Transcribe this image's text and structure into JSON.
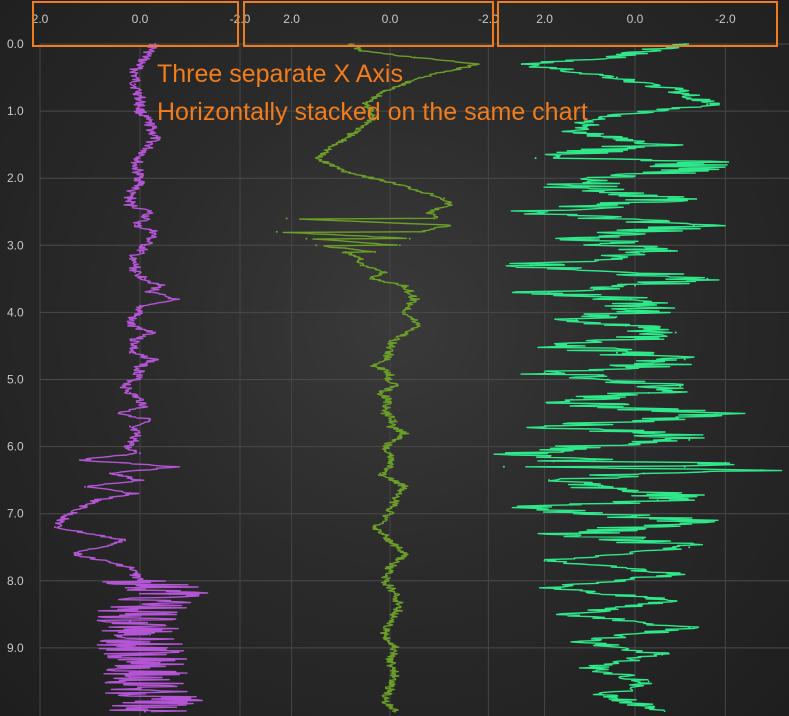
{
  "chart_data": {
    "type": "line",
    "title": "",
    "annotation_lines": [
      "Three separate X Axis",
      "Horizontally stacked on the same chart"
    ],
    "y_axis": {
      "ticks": [
        0.0,
        1.0,
        2.0,
        3.0,
        4.0,
        5.0,
        6.0,
        7.0,
        8.0,
        9.0
      ],
      "tick_labels": [
        "0.0",
        "1.0",
        "2.0",
        "3.0",
        "4.0",
        "5.0",
        "6.0",
        "7.0",
        "8.0",
        "9.0"
      ],
      "range": [
        0.0,
        9.95
      ],
      "reversed": true
    },
    "x_axes": [
      {
        "range": [
          2.5,
          -2.5
        ],
        "ticks": [
          2.0,
          0.0,
          -2.0
        ],
        "tick_labels": [
          "2.0",
          "0.0",
          "-2.0"
        ]
      },
      {
        "range": [
          2.5,
          -2.5
        ],
        "ticks": [
          2.0,
          0.0,
          -2.0
        ],
        "tick_labels": [
          "2.0",
          "0.0",
          "-2.0"
        ]
      },
      {
        "range": [
          2.5,
          -2.5
        ],
        "ticks": [
          2.0,
          0.0,
          -2.0
        ],
        "tick_labels": [
          "2.0",
          "0.0",
          "-2.0"
        ]
      }
    ],
    "grid": true,
    "axis_highlight_color": "#f07c1c",
    "series": [
      {
        "color": "#b455d6",
        "x": [
          -0.3,
          -0.1,
          0.1,
          0.1,
          0.0,
          0.0,
          -0.2,
          -0.3,
          -0.1,
          0.1,
          0.0,
          0.2,
          0.2,
          -0.1,
          -0.3,
          -0.1,
          0.2,
          0.1,
          -0.4,
          -0.7,
          0.0,
          0.2,
          0.1,
          0.2,
          0.0,
          0.1,
          0.2,
          -0.1,
          -0.2,
          0.1,
          0.3,
          1.2,
          0.6,
          1.1,
          0.9,
          1.4,
          1.7,
          0.3,
          1.3,
          0.2,
          0.0,
          -0.6,
          -0.1,
          0.2,
          -0.2,
          0.1,
          -0.4,
          -0.1,
          0.0,
          -0.4,
          -0.1,
          0.0,
          -0.2,
          0.1,
          -0.2,
          0.0,
          0.1,
          -0.1,
          -0.2,
          0.0,
          0.2,
          -0.3,
          0.1,
          -0.3,
          0.0,
          0.3,
          0.0,
          0.4,
          0.2,
          0.1,
          0.0,
          -0.7,
          0.0,
          0.1
        ],
        "y": [
          0.0,
          0.2,
          0.4,
          0.6,
          0.8,
          1.0,
          1.2,
          1.4,
          1.6,
          1.8,
          2.0,
          2.2,
          2.4,
          2.6,
          2.8,
          3.0,
          3.2,
          3.4,
          3.6,
          3.8,
          4.0,
          4.2,
          4.4,
          4.6,
          4.8,
          5.0,
          5.2,
          5.4,
          5.6,
          5.8,
          6.0,
          6.2,
          6.4,
          6.6,
          6.8,
          7.0,
          7.2,
          7.4,
          7.6,
          7.8,
          8.0,
          8.2,
          8.4,
          8.6,
          8.8,
          9.0,
          9.2,
          9.4,
          9.6,
          9.8,
          9.95,
          2.1,
          2.5,
          2.7,
          2.9,
          3.1,
          3.3,
          3.5,
          3.7,
          3.9,
          4.1,
          4.3,
          4.5,
          4.7,
          4.9,
          5.1,
          5.3,
          5.5,
          5.7,
          5.9,
          6.1,
          6.3,
          6.5,
          6.7
        ]
      },
      {
        "color": "#6a9e28",
        "x": [
          0.8,
          0.6,
          -0.5,
          -1.8,
          -0.6,
          0.1,
          0.5,
          0.3,
          0.7,
          1.1,
          1.5,
          0.9,
          -0.2,
          -1.1,
          -1.2,
          -0.8,
          -0.9,
          -1.2,
          -0.6,
          -0.4,
          -0.2,
          0.3,
          0.6,
          0.4,
          2.1,
          2.3,
          1.7,
          1.5,
          0.9,
          0.6,
          0.1,
          -0.3,
          -0.5,
          -0.3,
          -0.6,
          -0.1,
          0.0,
          0.3,
          0.0,
          0.2,
          0.1,
          -0.1,
          -0.3,
          0.1,
          0.0,
          0.2,
          -0.3,
          -0.1,
          0.0,
          0.3,
          0.0,
          -0.3,
          0.0,
          0.1,
          -0.1,
          -0.2,
          0.0,
          0.1,
          -0.1,
          0.0,
          -0.1,
          0.0,
          0.1,
          -0.1,
          0.0,
          0.1,
          0.0,
          -0.1,
          0.0,
          0.1,
          0.0,
          -0.1,
          0.0,
          0.0
        ],
        "y": [
          0.0,
          0.1,
          0.2,
          0.3,
          0.5,
          0.7,
          0.9,
          1.1,
          1.3,
          1.5,
          1.7,
          1.9,
          2.1,
          2.3,
          2.4,
          2.5,
          2.6,
          2.7,
          2.8,
          2.9,
          3.0,
          3.1,
          3.3,
          3.5,
          2.6,
          2.8,
          2.9,
          3.0,
          3.1,
          3.2,
          3.4,
          3.6,
          3.8,
          4.0,
          4.2,
          4.4,
          4.6,
          4.8,
          5.0,
          5.2,
          5.4,
          5.6,
          5.8,
          6.0,
          6.2,
          6.4,
          6.6,
          6.8,
          7.0,
          7.2,
          7.4,
          7.6,
          7.8,
          8.0,
          8.2,
          8.4,
          8.6,
          8.8,
          9.0,
          9.2,
          9.4,
          9.6,
          9.8,
          9.95,
          4.5,
          4.7,
          4.9,
          5.1,
          5.3,
          5.5,
          5.7,
          5.9,
          6.1,
          6.3
        ]
      },
      {
        "color": "#2ee88a",
        "x": [
          -1.1,
          0.5,
          2.5,
          0.4,
          -1.0,
          -1.6,
          0.8,
          1.4,
          -0.5,
          2.2,
          -0.9,
          1.5,
          -0.8,
          2.1,
          -1.3,
          1.0,
          -0.2,
          2.3,
          -1.6,
          1.9,
          -0.1,
          1.3,
          -0.9,
          1.6,
          -1.1,
          2.0,
          -1.0,
          1.4,
          -1.8,
          2.0,
          -1.2,
          2.6,
          -1.1,
          1.9,
          -0.8,
          2.1,
          -1.4,
          1.3,
          -1.2,
          2.0,
          -1.0,
          1.9,
          -0.9,
          1.5,
          -1.2,
          1.2,
          -0.6,
          1.0,
          -0.3,
          0.7,
          -0.4,
          0.9,
          -0.2,
          0.8,
          -0.5,
          1.0,
          -0.4,
          1.1,
          -0.6,
          0.9,
          -0.3,
          0.6,
          -0.2,
          0.4,
          0.0,
          0.2,
          -0.1,
          0.1,
          0.0,
          1.8,
          -2.0,
          2.9,
          -2.8,
          -1.5
        ],
        "y": [
          0.0,
          0.2,
          0.3,
          0.5,
          0.7,
          0.9,
          1.1,
          1.3,
          1.5,
          1.7,
          1.9,
          2.1,
          2.3,
          2.5,
          2.7,
          2.9,
          3.1,
          3.3,
          3.5,
          3.7,
          3.9,
          4.1,
          4.3,
          4.5,
          4.7,
          4.9,
          5.1,
          5.3,
          5.5,
          5.7,
          5.9,
          6.1,
          6.3,
          6.5,
          6.7,
          6.9,
          7.1,
          7.3,
          7.5,
          7.7,
          7.9,
          8.1,
          8.3,
          8.5,
          8.7,
          8.9,
          9.1,
          9.3,
          9.5,
          9.7,
          9.9,
          6.2,
          6.4,
          6.6,
          6.8,
          7.0,
          5.8,
          6.0,
          5.6,
          5.4,
          5.2,
          5.0,
          4.8,
          4.6,
          4.4,
          4.2,
          4.0,
          3.8,
          3.6,
          6.22,
          6.24,
          6.3,
          6.35,
          1.75
        ]
      }
    ]
  }
}
